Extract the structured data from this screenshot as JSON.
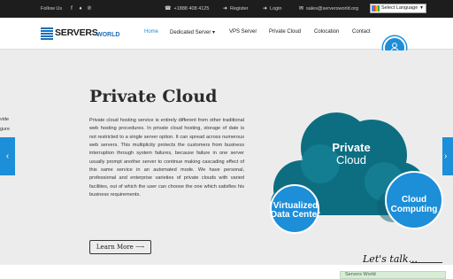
{
  "topbar": {
    "follow_us": "Follow Us",
    "social_icons": [
      "facebook-icon",
      "twitter-icon",
      "pinterest-icon"
    ],
    "phone": "+1888 408 4125",
    "register": "Register",
    "login": "Login",
    "email": "sales@serversworld.org",
    "language": "Select Language"
  },
  "logo": {
    "word1": "SERVERS",
    "word2": "WORLD"
  },
  "nav": {
    "items": [
      {
        "label": "Home"
      },
      {
        "label": "Dedicated Server ▾"
      },
      {
        "label": "VPS Server"
      },
      {
        "label": "Private Cloud"
      },
      {
        "label": "Colocation"
      },
      {
        "label": "Contact"
      }
    ]
  },
  "hero": {
    "prev_slide_fragments": [
      "vide",
      "gure"
    ],
    "title": "Private Cloud",
    "paragraph": "Private cloud hosting service is entirely different from other traditional web hosting procedures. In private cloud hosting, storage of date is not restricted to a single server option. It can spread across numerous web servers. This multiplicity protects the customers from business interruption through system failures, because failure in one server usually prompt another server to continue making cascading effect of this same service in an automated mode. We have personal, professional and enterprise varieties of private clouds with varied facilities, out of which the user can choose the one which satisfies his business requirements.",
    "learn_more": "Learn More ⟶",
    "cloud": {
      "main_line1": "Private",
      "main_line2": "Cloud",
      "left_line1": "Virtualized",
      "left_line2": "Data Center",
      "right_line1": "Cloud",
      "right_line2": "Computing"
    }
  },
  "chat": {
    "title": "Let's talk...",
    "company": "Servers World"
  },
  "colors": {
    "accent": "#1d8ed8",
    "cloud_dark": "#0d6e82",
    "cloud_mid": "#1a8aa0",
    "topbar": "#1d1d1d"
  }
}
